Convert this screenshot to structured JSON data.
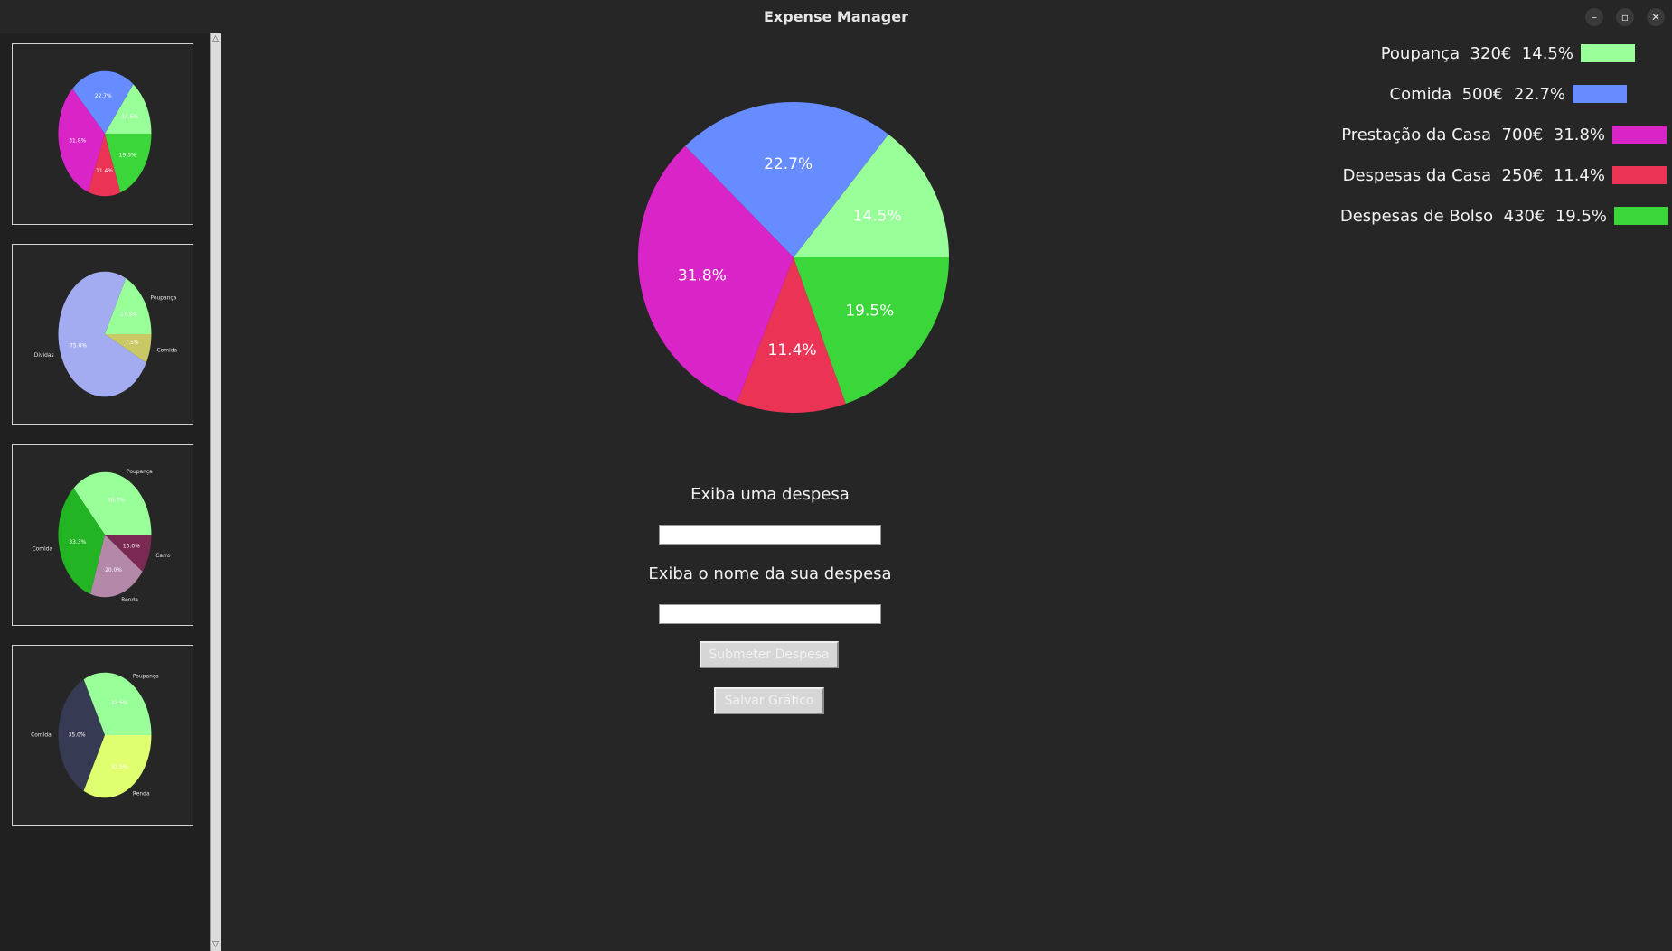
{
  "window": {
    "title": "Expense Manager",
    "min_icon": "minimize-icon",
    "max_icon": "maximize-icon",
    "close_icon": "close-icon"
  },
  "sidebar": {
    "thumbnails": [
      {
        "slices": [
          {
            "label": "",
            "pct": "14.5%",
            "color": "#99ff99"
          },
          {
            "label": "",
            "pct": "22.7%",
            "color": "#668cff"
          },
          {
            "label": "",
            "pct": "31.8%",
            "color": "#d924c7"
          },
          {
            "label": "",
            "pct": "11.4%",
            "color": "#ea3355"
          },
          {
            "label": "",
            "pct": "19.5%",
            "color": "#3ad63a"
          }
        ],
        "values": [
          14.5,
          22.7,
          31.8,
          11.4,
          19.5
        ]
      },
      {
        "slices": [
          {
            "label": "Poupança",
            "pct": "17.5%",
            "color": "#99ff99"
          },
          {
            "label": "Dividas",
            "pct": "75.0%",
            "color": "#a3acf0"
          },
          {
            "label": "Comida",
            "pct": "7.5%",
            "color": "#c8c864"
          }
        ],
        "values": [
          17.5,
          75.0,
          7.5
        ]
      },
      {
        "slices": [
          {
            "label": "Poupança",
            "pct": "36.7%",
            "color": "#99ff99"
          },
          {
            "label": "Comida",
            "pct": "33.3%",
            "color": "#22b422"
          },
          {
            "label": "Renda",
            "pct": "20.0%",
            "color": "#b488a8"
          },
          {
            "label": "Carro",
            "pct": "10.0%",
            "color": "#7a2a52"
          }
        ],
        "values": [
          36.7,
          33.3,
          20.0,
          10.0
        ]
      },
      {
        "slices": [
          {
            "label": "Poupança",
            "pct": "32.5%",
            "color": "#99ff99"
          },
          {
            "label": "Comida",
            "pct": "35.0%",
            "color": "#363a52"
          },
          {
            "label": "Renda",
            "pct": "32.5%",
            "color": "#dfff70"
          }
        ],
        "values": [
          32.5,
          35.0,
          32.5
        ]
      }
    ]
  },
  "chart_data": {
    "type": "pie",
    "categories": [
      "Poupança",
      "Comida",
      "Prestação da Casa",
      "Despesas da Casa",
      "Despesas de Bolso"
    ],
    "values": [
      320,
      500,
      700,
      250,
      430
    ],
    "percent_labels": [
      "14.5%",
      "22.7%",
      "31.8%",
      "11.4%",
      "19.5%"
    ],
    "colors": [
      "#99ff99",
      "#668cff",
      "#d924c7",
      "#ea3355",
      "#3ad63a"
    ],
    "start_angle_deg": 0,
    "direction": "counterclockwise"
  },
  "form": {
    "amount_label": "Exiba uma despesa",
    "amount_value": "",
    "name_label": "Exiba o nome da sua despesa",
    "name_value": "",
    "submit_label": "Submeter Despesa",
    "save_label": "Salvar Gráfico"
  },
  "legend": {
    "items": [
      {
        "text": "Poupança  320€  14.5%",
        "color": "#99ff99"
      },
      {
        "text": "Comida  500€  22.7%",
        "color": "#668cff"
      },
      {
        "text": "Prestação da Casa  700€  31.8%",
        "color": "#d924c7"
      },
      {
        "text": "Despesas da Casa  250€  11.4%",
        "color": "#ea3355"
      },
      {
        "text": "Despesas de Bolso  430€  19.5%",
        "color": "#3ad63a"
      }
    ]
  },
  "scrollbar": {
    "up_icon": "scroll-up-arrow-icon",
    "down_icon": "scroll-down-arrow-icon"
  }
}
